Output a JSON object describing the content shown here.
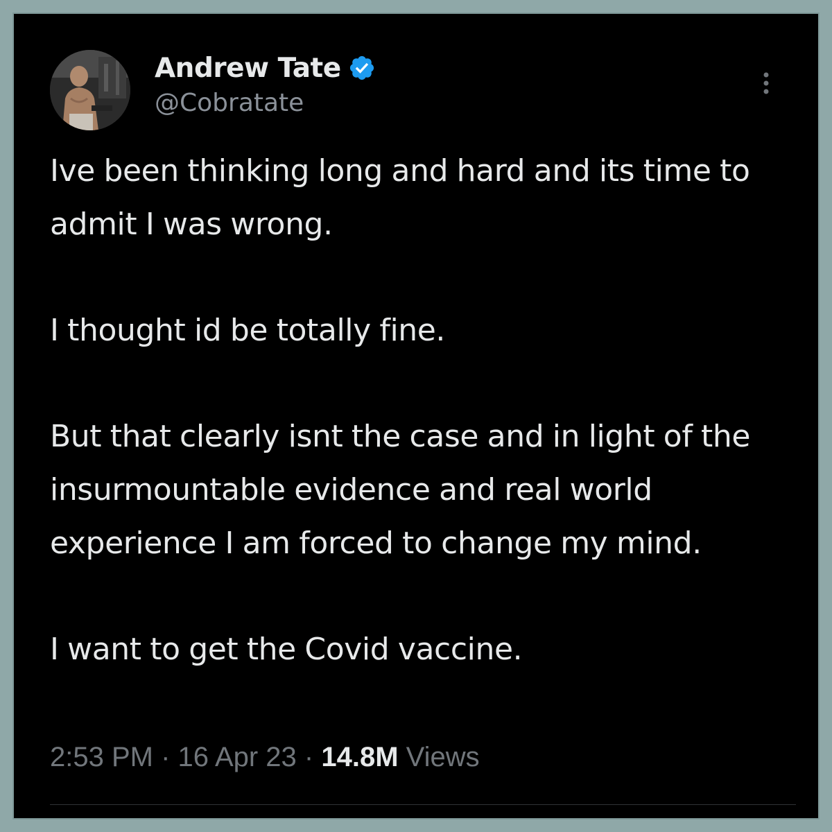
{
  "author": {
    "display_name": "Andrew Tate",
    "handle": "@Cobratate",
    "verified": true,
    "verified_color": "#1d9bf0"
  },
  "tweet": {
    "paragraphs": [
      "Ive been thinking long and hard and its time to admit I was wrong.",
      "I thought id be totally fine.",
      "But that clearly isnt the case and in light of the insurmountable evidence and real world experience I am forced to change my mind.",
      "I want to get the Covid vaccine."
    ]
  },
  "meta": {
    "time": "2:53 PM",
    "separator": "·",
    "date": "16 Apr 23",
    "views_count": "14.8M",
    "views_label": "Views"
  },
  "icons": {
    "more": "more-options-icon",
    "verified": "verified-badge-icon"
  },
  "colors": {
    "background": "#000000",
    "frame_border": "#8fa8a8",
    "text_primary": "#e7e9ea",
    "text_secondary": "#71767b"
  }
}
